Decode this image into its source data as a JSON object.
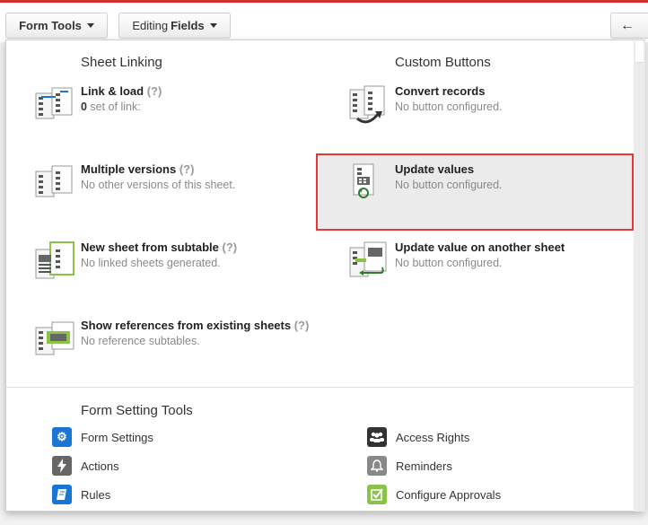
{
  "toolbar": {
    "form_tools_label": "Form Tools",
    "editing_label": "Editing",
    "fields_label": "Fields",
    "back_arrow": "←"
  },
  "sheet_linking": {
    "title": "Sheet Linking",
    "items": [
      {
        "name": "Link & load",
        "q": "(?)",
        "desc_count": "0",
        "desc": " set of link:"
      },
      {
        "name": "Multiple versions",
        "q": "(?)",
        "desc": "No other versions of this sheet."
      },
      {
        "name": "New sheet from subtable",
        "q": "(?)",
        "desc": "No linked sheets generated."
      },
      {
        "name": "Show references from existing sheets",
        "q": "(?)",
        "desc": "No reference subtables."
      }
    ]
  },
  "custom_buttons": {
    "title": "Custom Buttons",
    "items": [
      {
        "name": "Convert records",
        "desc": "No button configured."
      },
      {
        "name": "Update values",
        "desc": "No button configured."
      },
      {
        "name": "Update value on another sheet",
        "desc": "No button configured."
      }
    ]
  },
  "form_setting_tools": {
    "title": "Form Setting Tools",
    "items": [
      {
        "label": "Form Settings",
        "icon": "gears-icon",
        "color": "#1976d2"
      },
      {
        "label": "Access Rights",
        "icon": "users-icon",
        "color": "#333333"
      },
      {
        "label": "Actions",
        "icon": "lightning-icon",
        "color": "#666666"
      },
      {
        "label": "Reminders",
        "icon": "bell-icon",
        "color": "#888888"
      },
      {
        "label": "Rules",
        "icon": "book-icon",
        "color": "#1976d2"
      },
      {
        "label": "Configure Approvals",
        "icon": "checkbox-icon",
        "color": "#8bc34a"
      }
    ]
  },
  "colors": {
    "highlight_border": "#e53935",
    "link_blue": "#1976d2",
    "accent_green": "#8bc34a"
  }
}
